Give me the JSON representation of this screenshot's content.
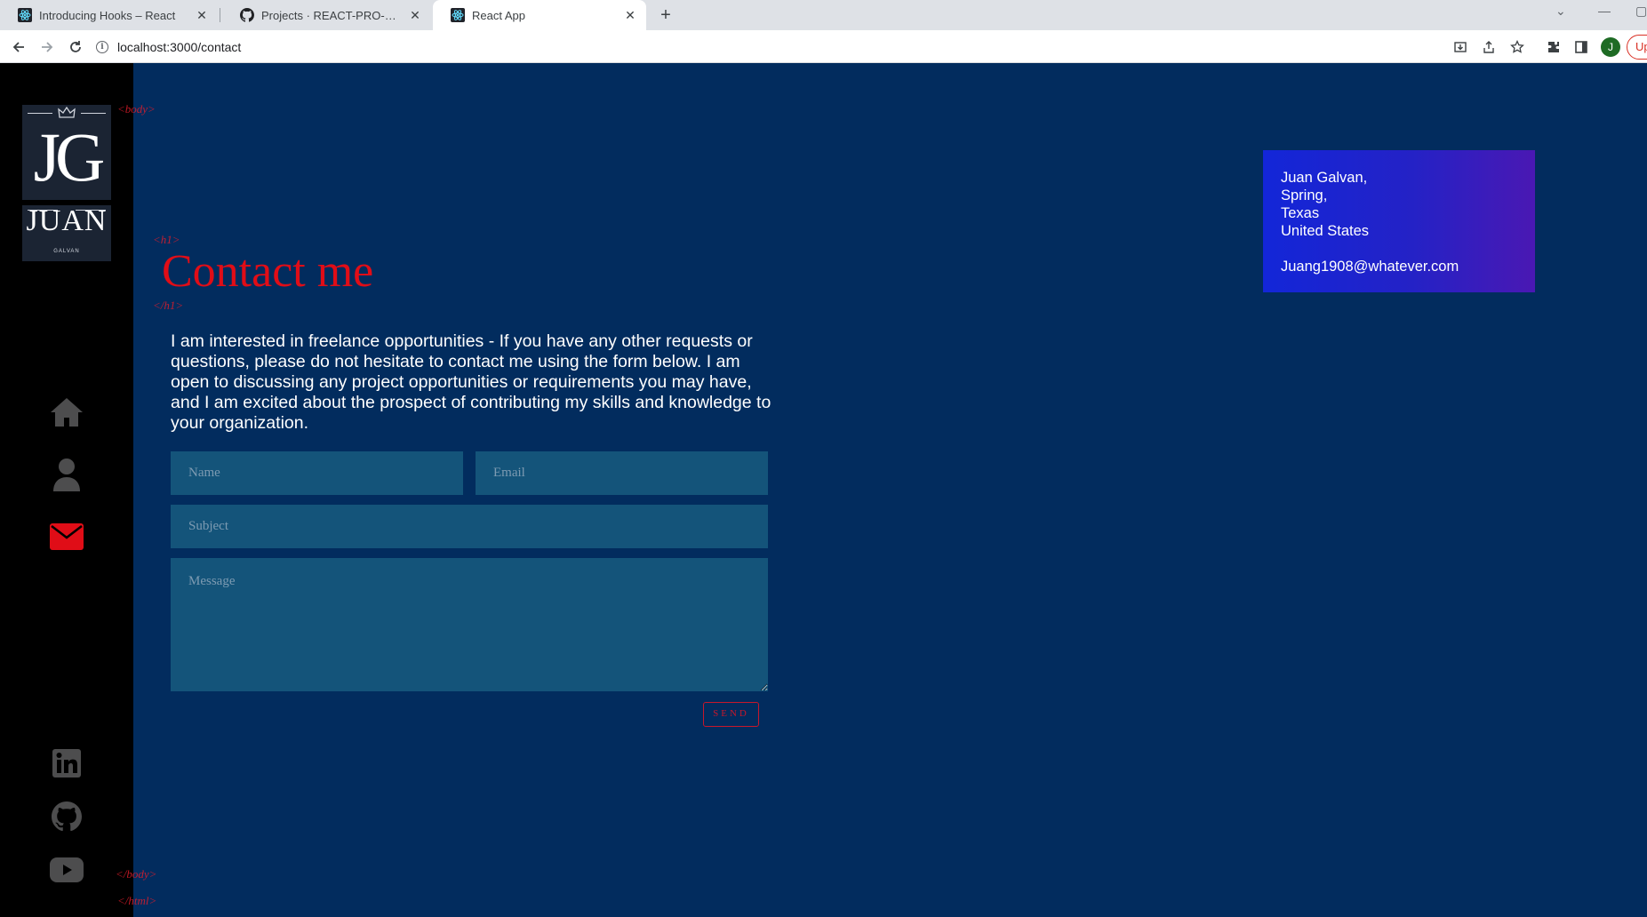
{
  "browser": {
    "tabs": [
      {
        "title": "Introducing Hooks – React",
        "active": false
      },
      {
        "title": "Projects · REACT-PRO-PORTFOLIO",
        "active": false
      },
      {
        "title": "React App",
        "active": true
      }
    ],
    "url": "localhost:3000/contact",
    "profile_initial": "J",
    "update_label": "Up"
  },
  "sidebar": {
    "logo": {
      "monogram": "JG",
      "name": "JUAN",
      "surname": "GALVAN"
    },
    "nav": [
      {
        "icon": "home-icon",
        "active": false
      },
      {
        "icon": "user-icon",
        "active": false
      },
      {
        "icon": "envelope-icon",
        "active": true
      }
    ],
    "social": [
      {
        "icon": "linkedin-icon"
      },
      {
        "icon": "github-icon"
      },
      {
        "icon": "youtube-icon"
      }
    ]
  },
  "decorations": {
    "body_open": "<body>",
    "h1_open": "<h1>",
    "h1_close": "</h1>",
    "body_close": "</body>",
    "html_close": "</html>"
  },
  "contact": {
    "heading": "Contact me",
    "intro": "I am interested in freelance opportunities - If you have any other requests or questions, please do not hesitate to contact me using the form below. I am open to discussing any project opportunities or requirements you may have, and I am excited about the prospect of contributing my skills and knowledge to your organization.",
    "form": {
      "name_placeholder": "Name",
      "email_placeholder": "Email",
      "subject_placeholder": "Subject",
      "message_placeholder": "Message",
      "send_label": "SEND"
    }
  },
  "info_card": {
    "lines": [
      "Juan Galvan,",
      "Spring,",
      "Texas",
      "United States"
    ],
    "email": "Juang1908@whatever.com"
  },
  "colors": {
    "background": "#022c5e",
    "accent": "#e00d17",
    "field": "#14547a",
    "sidebar": "#000000"
  }
}
